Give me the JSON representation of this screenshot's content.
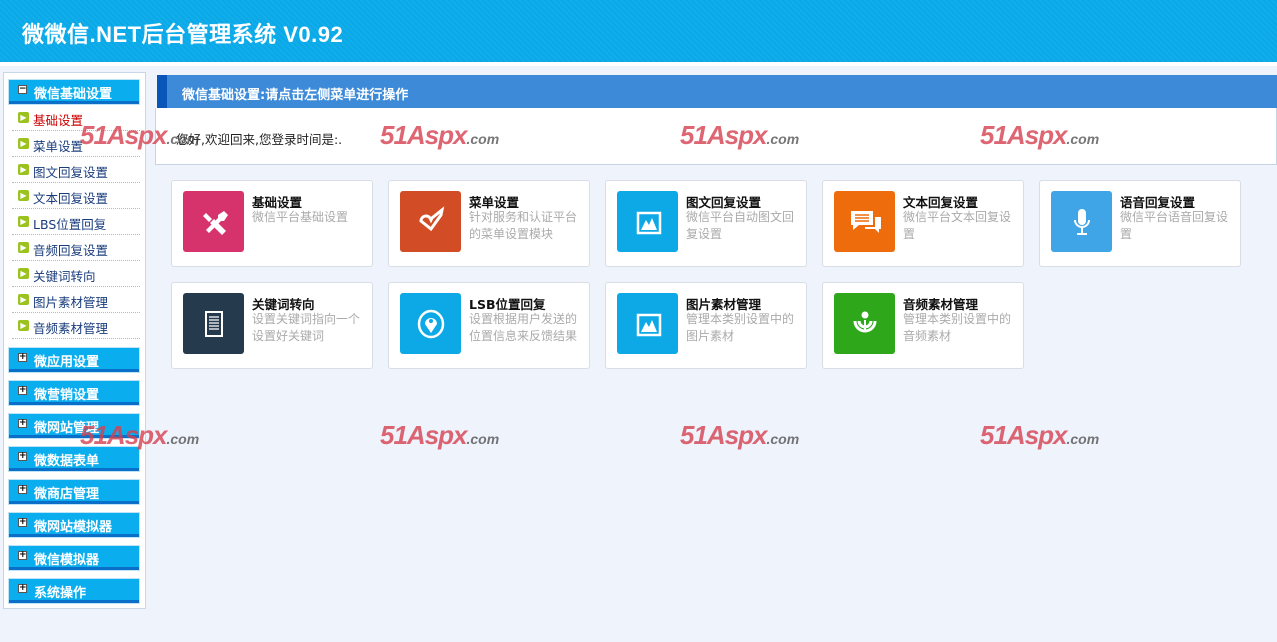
{
  "header": {
    "title": "微微信.NET后台管理系统 V0.92"
  },
  "sidebar": {
    "open_section": {
      "label": "微信基础设置",
      "toggle": "−"
    },
    "items": [
      {
        "label": "基础设置",
        "active": true
      },
      {
        "label": "菜单设置"
      },
      {
        "label": "图文回复设置"
      },
      {
        "label": "文本回复设置"
      },
      {
        "label": "LBS位置回复"
      },
      {
        "label": "音频回复设置"
      },
      {
        "label": "关键词转向"
      },
      {
        "label": "图片素材管理"
      },
      {
        "label": "音频素材管理"
      }
    ],
    "sections": [
      {
        "label": "微应用设置"
      },
      {
        "label": "微营销设置"
      },
      {
        "label": "微网站管理"
      },
      {
        "label": "微数据表单"
      },
      {
        "label": "微商店管理"
      },
      {
        "label": "微网站模拟器"
      },
      {
        "label": "微信模拟器"
      },
      {
        "label": "系统操作"
      }
    ],
    "collapsed_toggle": "+"
  },
  "main": {
    "title": "微信基础设置:请点击左侧菜单进行操作",
    "welcome": "您好,欢迎回来,您登录时间是:.",
    "cards": [
      {
        "title": "基础设置",
        "desc": "微信平台基础设置",
        "icon": "tools-icon",
        "color": "#d6336c"
      },
      {
        "title": "菜单设置",
        "desc": "针对服务和认证平台的菜单设置模块",
        "icon": "check-heart-icon",
        "color": "#d24d26"
      },
      {
        "title": "图文回复设置",
        "desc": "微信平台自动图文回复设置",
        "icon": "image-icon",
        "color": "#0ca9e6"
      },
      {
        "title": "文本回复设置",
        "desc": "微信平台文本回复设置",
        "icon": "chat-icon",
        "color": "#ef6c0c"
      },
      {
        "title": "语音回复设置",
        "desc": "微信平台语音回复设置",
        "icon": "microphone-icon",
        "color": "#3fa5e6"
      },
      {
        "title": "关键词转向",
        "desc": "设置关键词指向一个设置好关键词",
        "icon": "document-icon",
        "color": "#263a4e"
      },
      {
        "title": "LSB位置回复",
        "desc": "设置根据用户发送的位置信息来反馈结果",
        "icon": "location-pin-icon",
        "color": "#0ca9e6"
      },
      {
        "title": "图片素材管理",
        "desc": "管理本类别设置中的图片素材",
        "icon": "image-icon",
        "color": "#0ca9e6"
      },
      {
        "title": "音频素材管理",
        "desc": "管理本类别设置中的音频素材",
        "icon": "audio-icon",
        "color": "#2ea81a"
      }
    ]
  },
  "watermark": {
    "text": "51Aspx",
    ".com": ".com"
  }
}
